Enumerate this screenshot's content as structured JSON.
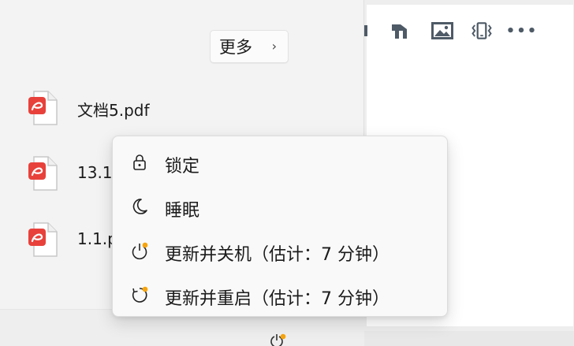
{
  "start_menu": {
    "more_button": {
      "label": "更多",
      "chevron": "›"
    },
    "recent_files": [
      {
        "name": "文档5.pdf",
        "icon": "pdf-file-icon"
      },
      {
        "name": "13.1.",
        "icon": "pdf-file-icon"
      },
      {
        "name": "1.1.p",
        "icon": "pdf-file-icon"
      }
    ]
  },
  "power_menu": {
    "items": [
      {
        "label": "锁定",
        "icon": "lock-icon"
      },
      {
        "label": "睡眠",
        "icon": "sleep-moon-icon"
      },
      {
        "label": "更新并关机（估计：7 分钟）",
        "icon": "update-shutdown-icon"
      },
      {
        "label": "更新并重启（估计：7 分钟）",
        "icon": "update-restart-icon"
      }
    ],
    "update_badge_color": "#f7a40c"
  },
  "toolbar": {
    "icons": [
      "partial-icon",
      "text-art-icon",
      "image-icon",
      "vibrate-icon",
      "more-icon"
    ],
    "more_label": "•••"
  },
  "colors": {
    "pdf_red": "#e8413b",
    "accent_orange": "#f7a40c"
  }
}
